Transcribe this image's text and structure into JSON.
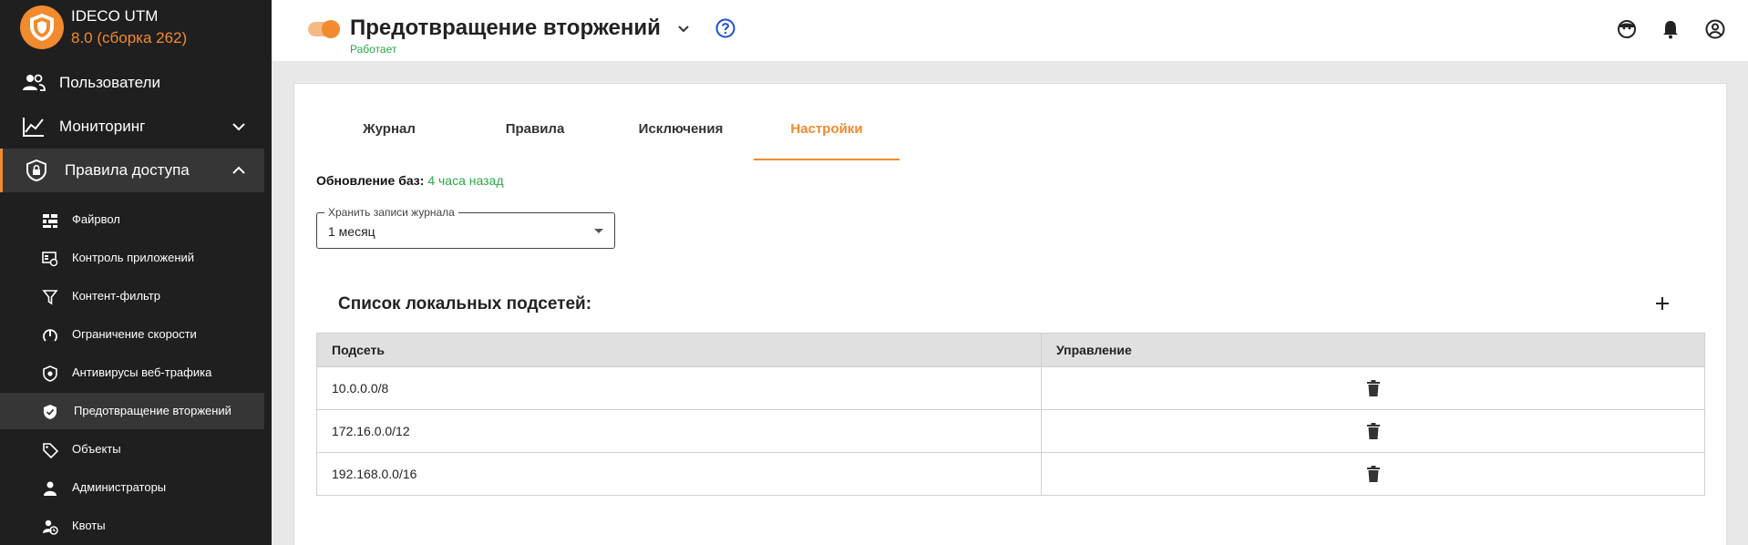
{
  "brand": {
    "name": "IDECO UTM",
    "version": "8.0 (сборка 262)"
  },
  "sidebar": {
    "items": [
      {
        "label": "Пользователи",
        "icon": "users-icon"
      },
      {
        "label": "Мониторинг",
        "icon": "chart-line-icon"
      },
      {
        "label": "Правила доступа",
        "icon": "shield-lock-icon"
      }
    ],
    "subitems": [
      {
        "label": "Файрвол",
        "icon": "brick-wall-icon"
      },
      {
        "label": "Контроль приложений",
        "icon": "app-control-icon"
      },
      {
        "label": "Контент-фильтр",
        "icon": "filter-icon"
      },
      {
        "label": "Ограничение скорости",
        "icon": "speedometer-icon"
      },
      {
        "label": "Антивирусы веб-трафика",
        "icon": "shield-virus-icon"
      },
      {
        "label": "Предотвращение вторжений",
        "icon": "shield-check-icon"
      },
      {
        "label": "Объекты",
        "icon": "tag-icon"
      },
      {
        "label": "Администраторы",
        "icon": "admin-icon"
      },
      {
        "label": "Квоты",
        "icon": "quota-icon"
      }
    ]
  },
  "header": {
    "title": "Предотвращение вторжений",
    "status": "Работает"
  },
  "tabs": [
    "Журнал",
    "Правила",
    "Исключения",
    "Настройки"
  ],
  "settings": {
    "update_label": "Обновление баз:",
    "update_value": "4 часа назад",
    "log_retention_label": "Хранить записи журнала",
    "log_retention_value": "1 месяц"
  },
  "subnets": {
    "title": "Список локальных подсетей:",
    "columns": [
      "Подсеть",
      "Управление"
    ],
    "rows": [
      "10.0.0.0/8",
      "172.16.0.0/12",
      "192.168.0.0/16"
    ]
  },
  "colors": {
    "accent": "#f28a2e",
    "success": "#2aa845",
    "sidebar": "#1f1f1f",
    "help": "#1a4fd6"
  }
}
